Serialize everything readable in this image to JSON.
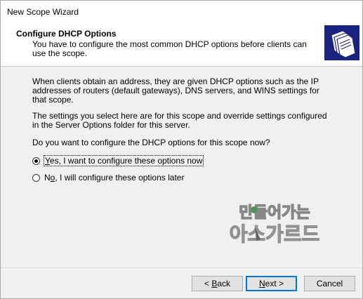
{
  "window": {
    "title": "New Scope Wizard"
  },
  "header": {
    "title": "Configure DHCP Options",
    "subtitle": "You have to configure the most common DHCP options before clients can use the scope.",
    "icon": "folders-icon"
  },
  "content": {
    "para1": "When clients obtain an address, they are given DHCP options such as the IP addresses of routers (default gateways), DNS servers, and WINS settings for that scope.",
    "para2": "The settings you select here are for this scope and override settings configured in the Server Options folder for this server.",
    "question": "Do you want to configure the DHCP options for this scope now?",
    "options": [
      {
        "mnemonic": "Y",
        "rest": "es, I want to configure these options now",
        "checked": true
      },
      {
        "mnemonic": "o",
        "prefix": "N",
        "rest": ", I will configure these options later",
        "checked": false
      }
    ]
  },
  "watermark": {
    "line1": "만들어가는",
    "line2": "아스가르드"
  },
  "buttons": {
    "back_mnemonic": "B",
    "back_prefix": "< ",
    "back_rest": "ack",
    "next_mnemonic": "N",
    "next_rest": "ext >",
    "cancel": "Cancel"
  },
  "colors": {
    "accent": "#0078d7",
    "icon_bg": "#1a237e"
  }
}
